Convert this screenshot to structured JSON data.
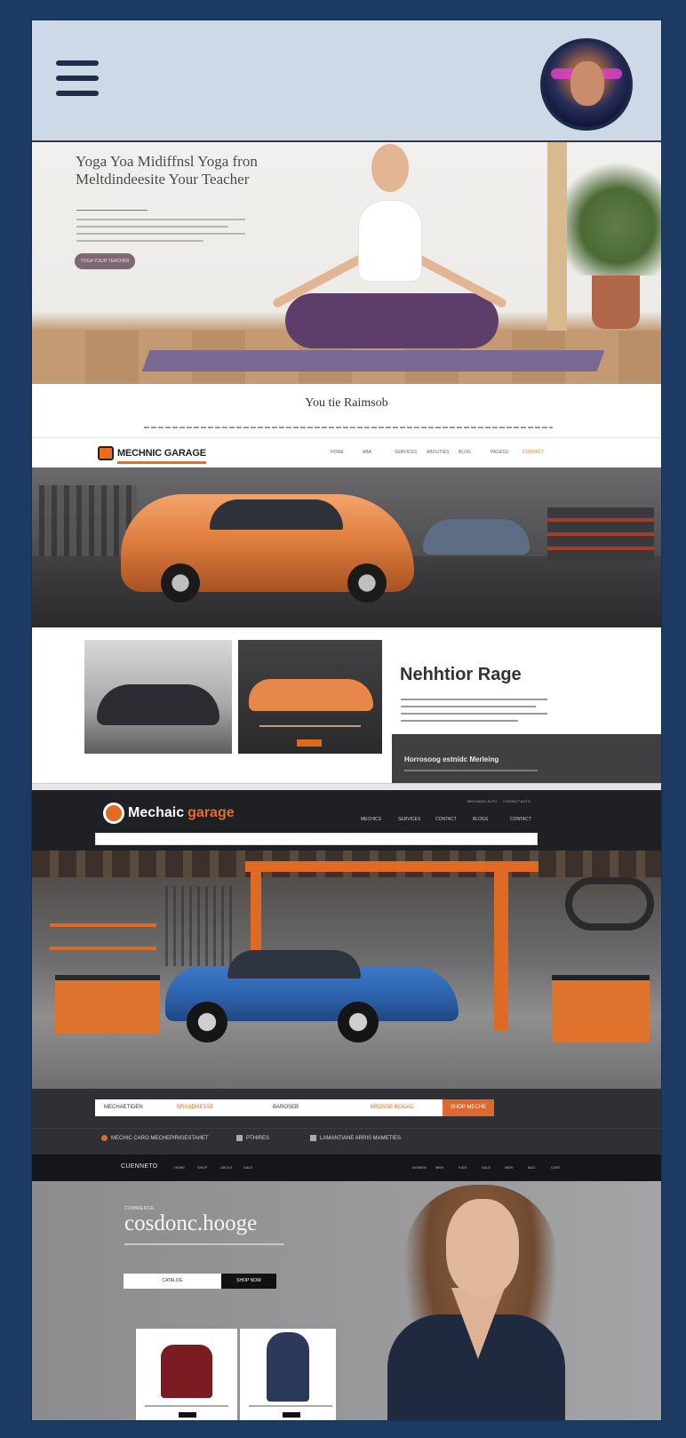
{
  "header": {
    "menu_icon": "hamburger-menu-icon",
    "avatar_icon": "user-avatar"
  },
  "yoga": {
    "title": "Yoga Yoa Midiffnsl Yoga fron Meltdindeesite Your Teacher",
    "cta": "YOGA YOUR TEACHER",
    "section_title": "You tie Raimsob"
  },
  "mechanic_one": {
    "logo": "MECHNIC GARAGE",
    "nav": [
      "HOME",
      "ABA",
      "SERVICES",
      "ABOUTIES",
      "BLOG",
      "PAGESS",
      "CONTACT"
    ],
    "heading": "Nehhtior Rage",
    "dark_title": "Horrosoog estnidc Merleing",
    "card_button": "SHOP"
  },
  "mechanic_two": {
    "logo_a": "Mechaic",
    "logo_b": "garage",
    "nav": [
      "MECHICS",
      "SERVICES",
      "CONTACT",
      "BLOGS",
      "CONTACT"
    ],
    "top_links": [
      "MECHANIC AUTO",
      "CONTACT AUTO"
    ],
    "form_fields": [
      "MECHAETIDEN",
      "BRANDNESSE",
      "BAROSEB",
      "BROSSE ROGAC"
    ],
    "go_button": "SHOP MECHE",
    "features": [
      "MECHIC CARO MECHEPIRIGESTAHET",
      "PTHIRES",
      "LAMANTIANE ARRIS MAMETIES"
    ]
  },
  "fashion": {
    "brand": "CUENNETO",
    "nav_left": [
      "HOME",
      "SHOP",
      "ABOUT",
      "SALE"
    ],
    "nav_right": [
      "WOMEN",
      "MEN",
      "KIDS",
      "SALE",
      "NEW",
      "BAG",
      "CART"
    ],
    "eyebrow": "COMMERCE",
    "title": "cosdonc.hooge",
    "button_light": "CATALOG",
    "button_dark": "SHOP NOW"
  }
}
